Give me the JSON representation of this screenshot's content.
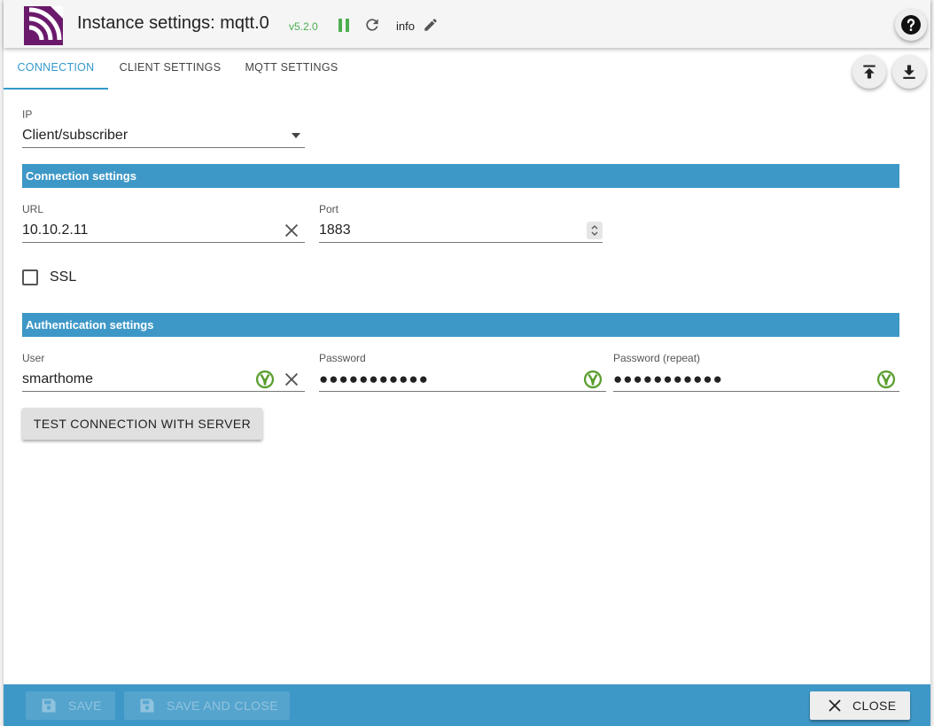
{
  "header": {
    "title": "Instance settings: mqtt.0",
    "version": "v5.2.0",
    "log_level": "info"
  },
  "tabs": [
    {
      "label": "CONNECTION",
      "active": true
    },
    {
      "label": "CLIENT SETTINGS",
      "active": false
    },
    {
      "label": "MQTT SETTINGS",
      "active": false
    }
  ],
  "form": {
    "ip": {
      "label": "IP",
      "value": "Client/subscriber"
    },
    "connection_section": "Connection settings",
    "url": {
      "label": "URL",
      "value": "10.10.2.11"
    },
    "port": {
      "label": "Port",
      "value": "1883"
    },
    "ssl": {
      "label": "SSL",
      "checked": false
    },
    "auth_section": "Authentication settings",
    "user": {
      "label": "User",
      "value": "smarthome"
    },
    "password": {
      "label": "Password",
      "value": "●●●●●●●●●●●"
    },
    "password_repeat": {
      "label": "Password (repeat)",
      "value": "●●●●●●●●●●●"
    },
    "test_button": "TEST CONNECTION WITH SERVER"
  },
  "footer": {
    "save": "SAVE",
    "save_close": "SAVE AND CLOSE",
    "close": "CLOSE"
  },
  "colors": {
    "accent": "#3e98c7",
    "brand": "#6b1a6b",
    "status_green": "#4caf50"
  }
}
